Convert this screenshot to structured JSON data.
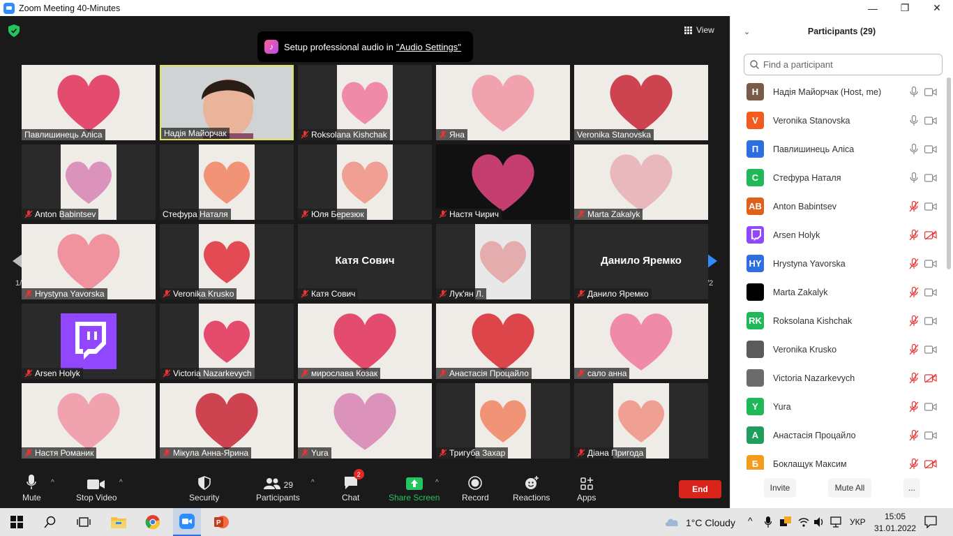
{
  "window": {
    "title": "Zoom Meeting 40-Minutes",
    "minimize": "—",
    "restore": "❐",
    "close": "✕"
  },
  "top": {
    "view_label": "View"
  },
  "toast": {
    "text": "Setup professional audio in",
    "link": "\"Audio Settings\""
  },
  "pager": {
    "left": "1/2",
    "right": "1/2"
  },
  "tiles": [
    {
      "name": "Павлишинець Аліса",
      "muted": false
    },
    {
      "name": "Надія Майорчак",
      "muted": false,
      "active": true
    },
    {
      "name": "Roksolana Kishchak",
      "muted": true
    },
    {
      "name": "Яна",
      "muted": true
    },
    {
      "name": "Veronika Stanovska",
      "muted": false
    },
    {
      "name": "Anton Babintsev",
      "muted": true
    },
    {
      "name": "Стефура Наталя",
      "muted": false
    },
    {
      "name": "Юля Березюк",
      "muted": true
    },
    {
      "name": "Настя Чирич",
      "muted": true
    },
    {
      "name": "Marta Zakalyk",
      "muted": true
    },
    {
      "name": "Hrystyna Yavorska",
      "muted": true
    },
    {
      "name": "Veronika Krusko",
      "muted": true
    },
    {
      "name": "Катя Сович",
      "muted": true,
      "center": "Катя Сович"
    },
    {
      "name": "Лук'ян Л.",
      "muted": true
    },
    {
      "name": "Данило Яремко",
      "muted": true,
      "center": "Данило Яремко"
    },
    {
      "name": "Arsen Holyk",
      "muted": true
    },
    {
      "name": "Victoria Nazarkevych",
      "muted": true
    },
    {
      "name": "мирослава Козак",
      "muted": true
    },
    {
      "name": "Анастасія Процайло",
      "muted": true
    },
    {
      "name": "сало анна",
      "muted": true
    },
    {
      "name": "Настя Романик",
      "muted": true
    },
    {
      "name": "Мікула Анна-Ярина",
      "muted": true
    },
    {
      "name": "Yura",
      "muted": true
    },
    {
      "name": "Тригуба Захар",
      "muted": true
    },
    {
      "name": "Діана Пригода",
      "muted": true
    }
  ],
  "toolbar": {
    "mute": "Mute",
    "stop_video": "Stop Video",
    "security": "Security",
    "participants": "Participants",
    "participants_count": "29",
    "chat": "Chat",
    "chat_badge": "2",
    "share": "Share Screen",
    "record": "Record",
    "reactions": "Reactions",
    "apps": "Apps",
    "end": "End"
  },
  "panel": {
    "title": "Participants (29)",
    "search_placeholder": "Find a participant",
    "invite": "Invite",
    "mute_all": "Mute All",
    "more": "...",
    "participants": [
      {
        "initials": "Н",
        "color": "#7a5a48",
        "name": "Надія Майорчак (Host, me)",
        "mic": "on",
        "cam": "on"
      },
      {
        "initials": "V",
        "color": "#f25b1d",
        "name": "Veronika Stanovska",
        "mic": "on",
        "cam": "on"
      },
      {
        "initials": "П",
        "color": "#2d6fe0",
        "name": "Павлишинець Аліса",
        "mic": "on",
        "cam": "on"
      },
      {
        "initials": "С",
        "color": "#21b85a",
        "name": "Стефура Наталя",
        "mic": "on",
        "cam": "on"
      },
      {
        "initials": "AB",
        "color": "#e0601a",
        "name": "Anton Babintsev",
        "mic": "off",
        "cam": "on"
      },
      {
        "initials": "",
        "color": "#9147ff",
        "name": "Arsen Holyk",
        "mic": "off",
        "cam": "off"
      },
      {
        "initials": "HY",
        "color": "#2d6fe0",
        "name": "Hrystyna Yavorska",
        "mic": "off",
        "cam": "on"
      },
      {
        "initials": "",
        "color": "#000000",
        "name": "Marta Zakalyk",
        "mic": "off",
        "cam": "on"
      },
      {
        "initials": "RK",
        "color": "#21b85a",
        "name": "Roksolana Kishchak",
        "mic": "off",
        "cam": "on"
      },
      {
        "initials": "",
        "color": "#5a5a5a",
        "name": "Veronika Krusko",
        "mic": "off",
        "cam": "on"
      },
      {
        "initials": "",
        "color": "#6b6b6b",
        "name": "Victoria Nazarkevych",
        "mic": "off",
        "cam": "off"
      },
      {
        "initials": "Y",
        "color": "#21b85a",
        "name": "Yura",
        "mic": "off",
        "cam": "on"
      },
      {
        "initials": "А",
        "color": "#1f9e5e",
        "name": "Анастасія Процайло",
        "mic": "off",
        "cam": "on"
      },
      {
        "initials": "Б",
        "color": "#f29b1d",
        "name": "Боклащук Максим",
        "mic": "off",
        "cam": "off"
      }
    ]
  },
  "taskbar": {
    "weather": "1°C  Cloudy",
    "lang": "УКР",
    "time": "15:05",
    "date": "31.01.2022"
  }
}
